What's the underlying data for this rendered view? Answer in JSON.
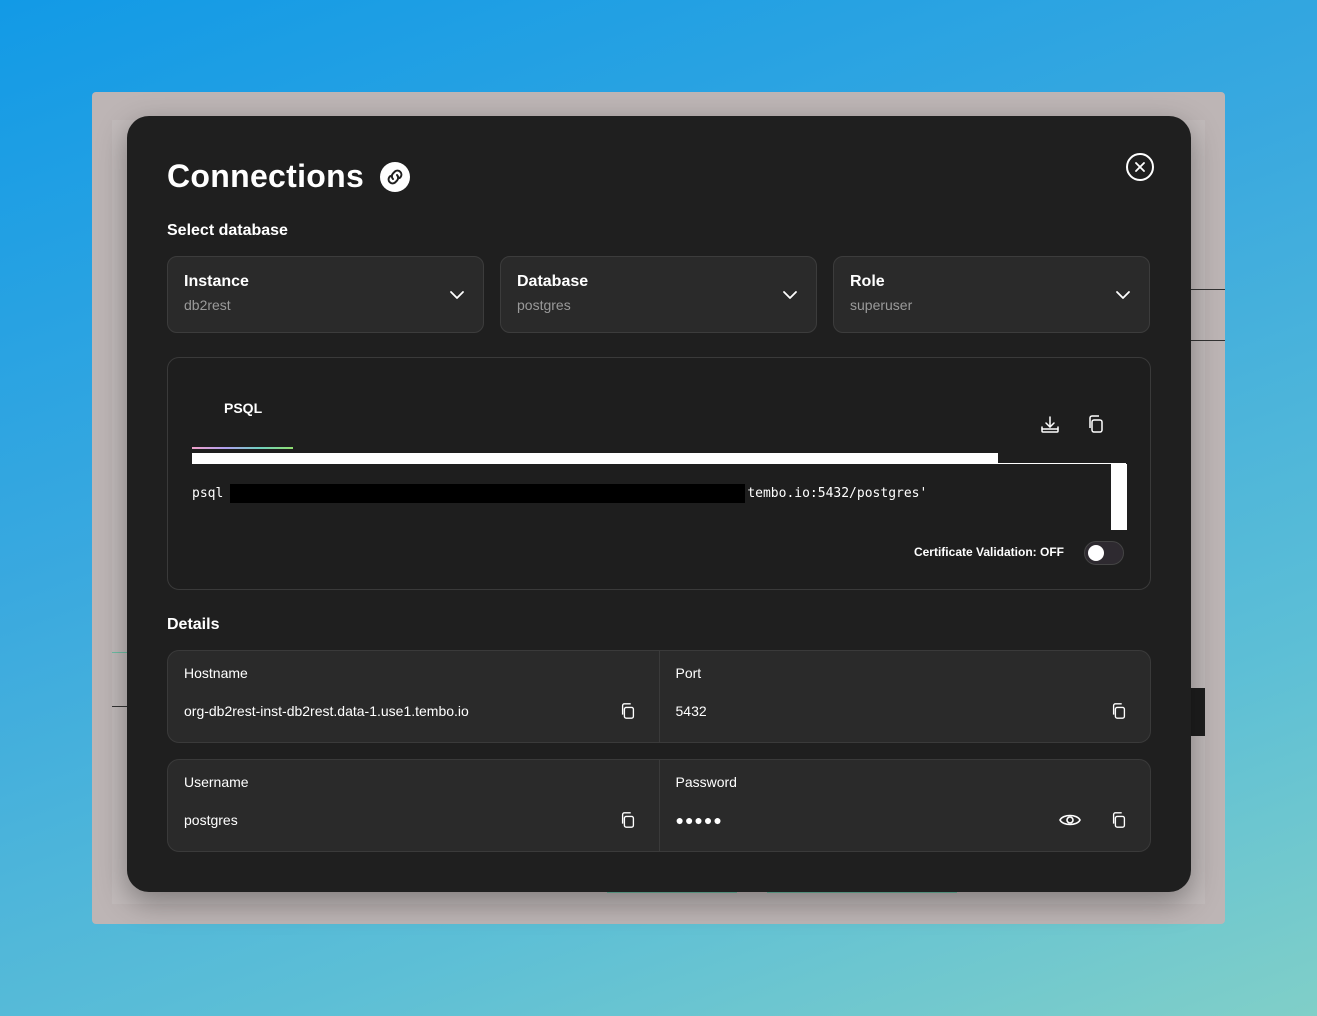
{
  "modal": {
    "title": "Connections",
    "select_database_label": "Select database",
    "selects": [
      {
        "label": "Instance",
        "value": "db2rest"
      },
      {
        "label": "Database",
        "value": "postgres"
      },
      {
        "label": "Role",
        "value": "superuser"
      }
    ],
    "connection": {
      "tab": "PSQL",
      "command_prefix": "psql",
      "command_suffix": "tembo.io:5432/postgres'",
      "cert_validation": "Certificate Validation: OFF"
    },
    "details_label": "Details",
    "details": [
      {
        "label": "Hostname",
        "value": "org-db2rest-inst-db2rest.data-1.use1.tembo.io"
      },
      {
        "label": "Port",
        "value": "5432"
      },
      {
        "label": "Username",
        "value": "postgres"
      },
      {
        "label": "Password",
        "value": "●●●●●"
      }
    ]
  },
  "colors": {
    "modal_bg": "#1f1f1f",
    "card_bg": "#2a2a2a",
    "muted_text": "#9a9a9a"
  }
}
